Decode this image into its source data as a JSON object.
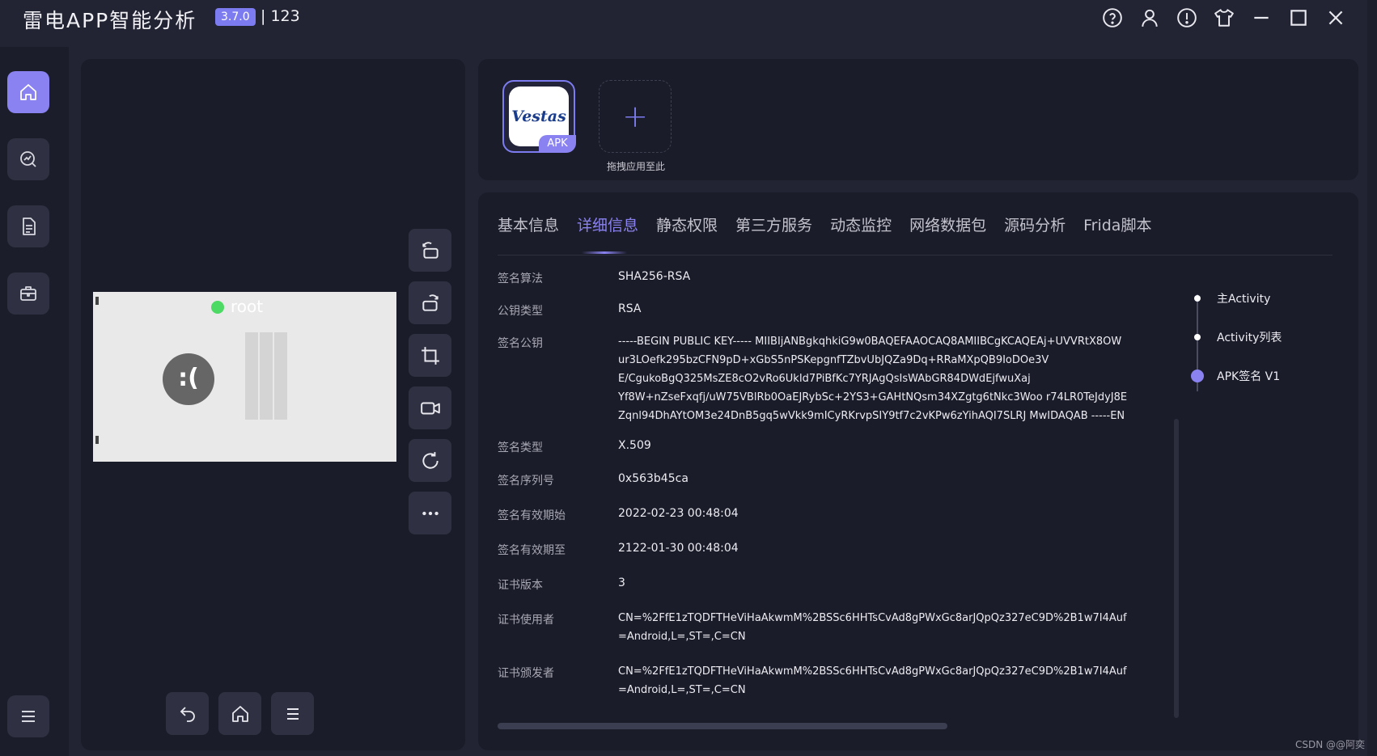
{
  "titlebar": {
    "title": "雷电APP智能分析",
    "version": "3.7.0",
    "extra": "| 123",
    "icons": [
      "help-icon",
      "user-icon",
      "info-icon",
      "shirt-icon",
      "minimize-icon",
      "maximize-icon",
      "close-icon"
    ]
  },
  "leftnav": {
    "items": [
      {
        "name": "home-icon",
        "active": true
      },
      {
        "name": "analysis-icon",
        "active": false
      },
      {
        "name": "document-icon",
        "active": false
      },
      {
        "name": "toolbox-icon",
        "active": false
      }
    ],
    "menu_icon": "menu-icon"
  },
  "device": {
    "root_label": "root",
    "face": ":(",
    "tools": [
      "rotate-left-icon",
      "rotate-right-icon",
      "crop-icon",
      "record-icon",
      "refresh-icon",
      "more-icon"
    ],
    "bottom_nav": [
      "back-icon",
      "home-icon",
      "menu-icon"
    ]
  },
  "apps": {
    "apk_name": "Vestas",
    "apk_badge": "APK",
    "add_label": "拖拽应用至此"
  },
  "tabs": [
    "基本信息",
    "详细信息",
    "静态权限",
    "第三方服务",
    "动态监控",
    "网络数据包",
    "源码分析",
    "Frida脚本"
  ],
  "active_tab": "详细信息",
  "details": [
    {
      "label": "签名算法",
      "value": "SHA256-RSA"
    },
    {
      "label": "公钥类型",
      "value": "RSA"
    },
    {
      "label": "签名公钥",
      "value": "-----BEGIN PUBLIC KEY----- MIIBIjANBgkqhkiG9w0BAQEFAAOCAQ8AMIIBCgKCAQEAj+UVVRtX8OW\nur3LOefk295bzCFN9pD+xGbS5nPSKepgnfTZbvUbJQZa9Dq+RRaMXpQB9IoDOe3V\nE/CgukoBgQ325MsZE8cO2vRo6UkId7PiBfKc7YRJAgQsIsWAbGR84DWdEjfwuXaj\nYf8W+nZseFxqfj/uW75VBlRb0OaEJRybSc+2YS3+GAHtNQsm34XZgtg6tNkc3Woo r74LR0TeJdyJ8E\nZqnl94DhAYtOM3e24DnB5gq5wVkk9mICyRKrvpSIY9tf7c2vKPw6zYihAQI7SLRJ MwIDAQAB -----EN"
    },
    {
      "label": "签名类型",
      "value": "X.509"
    },
    {
      "label": "签名序列号",
      "value": "0x563b45ca"
    },
    {
      "label": "签名有效期始",
      "value": "2022-02-23 00:48:04"
    },
    {
      "label": "签名有效期至",
      "value": "2122-01-30 00:48:04"
    },
    {
      "label": "证书版本",
      "value": "3"
    },
    {
      "label": "证书使用者",
      "value": "CN=%2FfE1zTQDFTHeViHaAkwmM%2BSSc6HHTsCvAd8gPWxGc8arJQpQz327eC9D%2B1w7I4Auf\n=Android,L=,ST=,C=CN"
    },
    {
      "label": "证书颁发者",
      "value": "CN=%2FfE1zTQDFTHeViHaAkwmM%2BSSc6HHTsCvAd8gPWxGc8arJQpQz327eC9D%2B1w7I4Auf\n=Android,L=,ST=,C=CN"
    }
  ],
  "side_steps": [
    "主Activity",
    "Activity列表",
    "APK签名 V1"
  ],
  "watermark": "CSDN @@阿奕",
  "colors": {
    "accent": "#8a82f0",
    "bg": "#222434",
    "panel": "#1b1c29",
    "root_dot": "#4cd964"
  }
}
